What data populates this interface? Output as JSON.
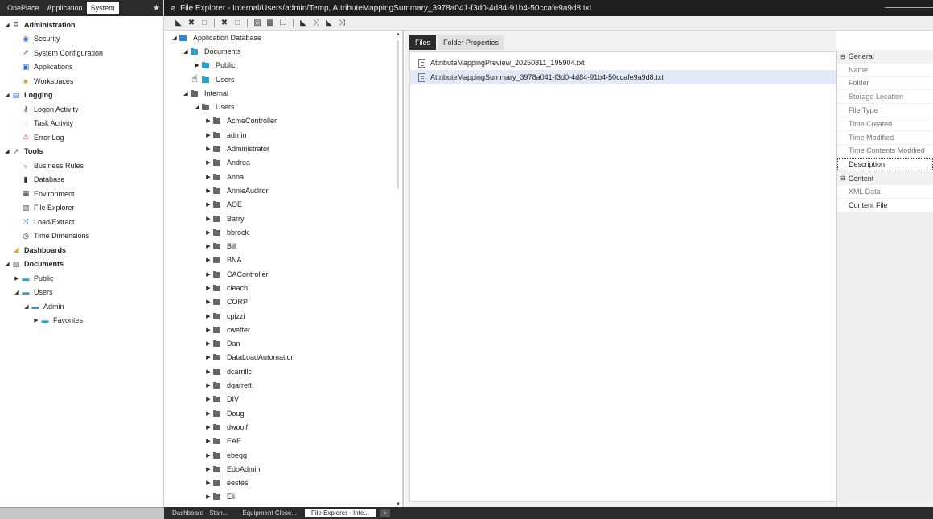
{
  "nav": {
    "tabs": [
      "OnePlace",
      "Application",
      "System"
    ],
    "active_tab": 2,
    "pin_glyph": "★",
    "items": [
      {
        "label": "Administration",
        "level": 0,
        "caret": "◢",
        "icon": "⚙",
        "bold": true,
        "color": "#555"
      },
      {
        "label": "Security",
        "level": 1,
        "caret": "",
        "icon": "◉",
        "color": "#3a6fd0"
      },
      {
        "label": "System Configuration",
        "level": 1,
        "caret": "",
        "icon": "↗",
        "color": "#444"
      },
      {
        "label": "Applications",
        "level": 1,
        "caret": "",
        "icon": "▣",
        "color": "#2f66c8"
      },
      {
        "label": "Workspaces",
        "level": 1,
        "caret": "",
        "icon": "■",
        "color": "#e6a23a"
      },
      {
        "label": "Logging",
        "level": 0,
        "caret": "◢",
        "icon": "▤",
        "bold": true,
        "color": "#2f66c8"
      },
      {
        "label": "Logon Activity",
        "level": 1,
        "caret": "",
        "icon": "⚷",
        "color": "#444"
      },
      {
        "label": "Task Activity",
        "level": 1,
        "caret": "",
        "icon": "◌",
        "color": "#2aa84a"
      },
      {
        "label": "Error Log",
        "level": 1,
        "caret": "",
        "icon": "⚠",
        "color": "#d03030"
      },
      {
        "label": "Tools",
        "level": 0,
        "caret": "◢",
        "icon": "↗",
        "bold": true,
        "color": "#444"
      },
      {
        "label": "Business Rules",
        "level": 1,
        "caret": "",
        "icon": "√",
        "color": "#3a6fd0"
      },
      {
        "label": "Database",
        "level": 1,
        "caret": "",
        "icon": "▮",
        "color": "#333"
      },
      {
        "label": "Environment",
        "level": 1,
        "caret": "",
        "icon": "▦",
        "color": "#333"
      },
      {
        "label": "File Explorer",
        "level": 1,
        "caret": "",
        "icon": "▧",
        "color": "#555"
      },
      {
        "label": "Load/Extract",
        "level": 1,
        "caret": "",
        "icon": "⤨",
        "color": "#3a6fd0"
      },
      {
        "label": "Time Dimensions",
        "level": 1,
        "caret": "",
        "icon": "◷",
        "color": "#333"
      },
      {
        "label": "Dashboards",
        "level": 0,
        "caret": "",
        "icon": "◢",
        "bold": true,
        "color": "#e6a23a"
      },
      {
        "label": "Documents",
        "level": 0,
        "caret": "◢",
        "icon": "▧",
        "bold": true,
        "color": "#555"
      },
      {
        "label": "Public",
        "level": 1,
        "caret": "▶",
        "icon": "▬",
        "color": "#2aa0c8"
      },
      {
        "label": "Users",
        "level": 1,
        "caret": "◢",
        "icon": "▬",
        "color": "#2aa0c8"
      },
      {
        "label": "Admin",
        "level": 2,
        "caret": "◢",
        "icon": "▬",
        "color": "#2aa0c8"
      },
      {
        "label": "Favorites",
        "level": 3,
        "caret": "▶",
        "icon": "▬",
        "color": "#2aa0c8"
      }
    ]
  },
  "titlebar": {
    "icon": "⌀",
    "text": "File Explorer - Internal/Users/admin/Temp, AttributeMappingSummary_3978a041-f3d0-4d84-91b4-50ccafe9a9d8.txt"
  },
  "toolbar": {
    "buttons": [
      {
        "name": "open-folder-icon",
        "glyph": "◣"
      },
      {
        "name": "delete-icon",
        "glyph": "✖"
      },
      {
        "name": "save-icon",
        "glyph": "□",
        "dim": true
      },
      {
        "sep": true
      },
      {
        "name": "cancel-icon",
        "glyph": "✖"
      },
      {
        "name": "save-all-icon",
        "glyph": "□",
        "dim": true
      },
      {
        "sep": true
      },
      {
        "name": "upload-icon",
        "glyph": "▨"
      },
      {
        "name": "download-icon",
        "glyph": "▩"
      },
      {
        "name": "copy-icon",
        "glyph": "❐"
      },
      {
        "sep": true
      },
      {
        "name": "new-folder-icon",
        "glyph": "◣"
      },
      {
        "name": "move-icon",
        "glyph": "⤨"
      },
      {
        "name": "add-folder-icon",
        "glyph": "◣"
      },
      {
        "name": "sync-icon",
        "glyph": "⤨"
      }
    ]
  },
  "tree": {
    "items": [
      {
        "label": "Application Database",
        "level": 0,
        "caret": "◢",
        "folder": "blue"
      },
      {
        "label": "Documents",
        "level": 1,
        "caret": "◢",
        "folder": "teal"
      },
      {
        "label": "Public",
        "level": 2,
        "caret": "▶",
        "folder": "teal"
      },
      {
        "label": "Users",
        "level": 2,
        "caret": "",
        "folder": "teal"
      },
      {
        "label": "Internal",
        "level": 1,
        "caret": "◢",
        "folder": "grey"
      },
      {
        "label": "Users",
        "level": 2,
        "caret": "◢",
        "folder": "grey"
      },
      {
        "label": "AcmeController",
        "level": 3,
        "caret": "▶",
        "folder": "grey"
      },
      {
        "label": "admin",
        "level": 3,
        "caret": "▶",
        "folder": "grey"
      },
      {
        "label": "Administrator",
        "level": 3,
        "caret": "▶",
        "folder": "grey"
      },
      {
        "label": "Andrea",
        "level": 3,
        "caret": "▶",
        "folder": "grey"
      },
      {
        "label": "Anna",
        "level": 3,
        "caret": "▶",
        "folder": "grey"
      },
      {
        "label": "AnnieAuditor",
        "level": 3,
        "caret": "▶",
        "folder": "grey"
      },
      {
        "label": "AOE",
        "level": 3,
        "caret": "▶",
        "folder": "grey"
      },
      {
        "label": "Barry",
        "level": 3,
        "caret": "▶",
        "folder": "grey"
      },
      {
        "label": "bbrock",
        "level": 3,
        "caret": "▶",
        "folder": "grey"
      },
      {
        "label": "Bill",
        "level": 3,
        "caret": "▶",
        "folder": "grey"
      },
      {
        "label": "BNA",
        "level": 3,
        "caret": "▶",
        "folder": "grey"
      },
      {
        "label": "CAController",
        "level": 3,
        "caret": "▶",
        "folder": "grey"
      },
      {
        "label": "cleach",
        "level": 3,
        "caret": "▶",
        "folder": "grey"
      },
      {
        "label": "CORP",
        "level": 3,
        "caret": "▶",
        "folder": "grey"
      },
      {
        "label": "cpizzi",
        "level": 3,
        "caret": "▶",
        "folder": "grey"
      },
      {
        "label": "cwetter",
        "level": 3,
        "caret": "▶",
        "folder": "grey"
      },
      {
        "label": "Dan",
        "level": 3,
        "caret": "▶",
        "folder": "grey"
      },
      {
        "label": "DataLoadAutomation",
        "level": 3,
        "caret": "▶",
        "folder": "grey"
      },
      {
        "label": "dcarrillc",
        "level": 3,
        "caret": "▶",
        "folder": "grey"
      },
      {
        "label": "dgarrett",
        "level": 3,
        "caret": "▶",
        "folder": "grey"
      },
      {
        "label": "DIV",
        "level": 3,
        "caret": "▶",
        "folder": "grey"
      },
      {
        "label": "Doug",
        "level": 3,
        "caret": "▶",
        "folder": "grey"
      },
      {
        "label": "dwoolf",
        "level": 3,
        "caret": "▶",
        "folder": "grey"
      },
      {
        "label": "EAE",
        "level": 3,
        "caret": "▶",
        "folder": "grey"
      },
      {
        "label": "ebegg",
        "level": 3,
        "caret": "▶",
        "folder": "grey"
      },
      {
        "label": "EdoAdmin",
        "level": 3,
        "caret": "▶",
        "folder": "grey"
      },
      {
        "label": "eestes",
        "level": 3,
        "caret": "▶",
        "folder": "grey"
      },
      {
        "label": "Eli",
        "level": 3,
        "caret": "▶",
        "folder": "grey"
      }
    ]
  },
  "files_pane": {
    "tabs": [
      "Files",
      "Folder Properties"
    ],
    "active_tab": 0,
    "files": [
      {
        "name": "AttributeMappingPreview_20250811_195904.txt",
        "selected": false
      },
      {
        "name": "AttributeMappingSummary_3978a041-f3d0-4d84-91b4-50ccafe9a9d8.txt",
        "selected": true
      }
    ]
  },
  "properties": {
    "rows": [
      {
        "label": "General",
        "cat": true
      },
      {
        "label": "Name"
      },
      {
        "label": "Folder"
      },
      {
        "label": "Storage Location"
      },
      {
        "label": "File Type"
      },
      {
        "label": "Time Created"
      },
      {
        "label": "Time Modified"
      },
      {
        "label": "Time Contents Modified"
      },
      {
        "label": "Description",
        "focus": true
      },
      {
        "label": "Content",
        "cat": true
      },
      {
        "label": "XML Data"
      },
      {
        "label": "Content File",
        "dark": true
      }
    ]
  },
  "taskbar": {
    "tasks": [
      {
        "label": "Dashboard - Stan...",
        "active": false
      },
      {
        "label": "Equipment Close...",
        "active": false
      },
      {
        "label": "File Explorer - Inte...",
        "active": true
      }
    ],
    "add_label": "+"
  }
}
